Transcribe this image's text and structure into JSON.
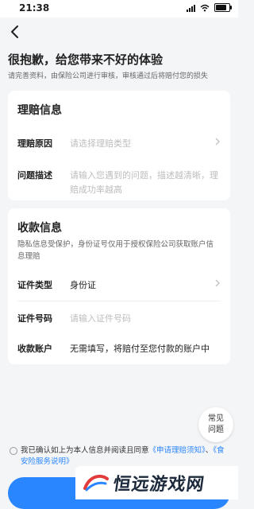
{
  "status_bar": {
    "time": "21:38"
  },
  "header": {
    "title": "很抱歉，给您带来不好的体验",
    "subtitle": "请完善资料，由保险公司进行审核，审核通过后将赔付您的损失"
  },
  "claim_card": {
    "title": "理赔信息",
    "reason_label": "理赔原因",
    "reason_placeholder": "请选择理赔类型",
    "desc_label": "问题描述",
    "desc_placeholder": "请输入您遇到的问题，描述越清晰，理赔成功率越高"
  },
  "payee_card": {
    "title": "收款信息",
    "desc": "隐私信息受保护，身份证号仅用于授权保险公司获取账户信息理赔",
    "id_type_label": "证件类型",
    "id_type_value": "身份证",
    "id_number_label": "证件号码",
    "id_number_placeholder": "请输入证件号码",
    "account_label": "收款账户",
    "account_value": "无需填写，将赔付至您付款的账户中"
  },
  "faq": {
    "label": "常见问题"
  },
  "agreement": {
    "text": "我已确认如上为本人信息并阅读且同意",
    "link1": "《申请理赔须知》",
    "sep": "、",
    "link2": "《食安险服务说明》"
  },
  "watermark": {
    "text": "恒远游戏网"
  },
  "colors": {
    "accent": "#2a86ff",
    "background": "#f4f5f7"
  },
  "icons": {
    "back": "chevron-left-icon",
    "chevron": "chevron-right-icon"
  }
}
